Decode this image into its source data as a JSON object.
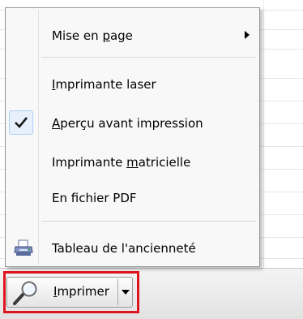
{
  "menu": {
    "items": [
      {
        "id": "mise-en-page",
        "before": "Mise en ",
        "accel": "p",
        "after": "age",
        "has_submenu": true
      },
      {
        "id": "imprimante-laser",
        "before": "",
        "accel": "I",
        "after": "mprimante laser"
      },
      {
        "id": "apercu",
        "before": "",
        "accel": "A",
        "after": "perçu avant impression",
        "checked": true
      },
      {
        "id": "matricielle",
        "before": "Imprimante ",
        "accel": "m",
        "after": "atricielle"
      },
      {
        "id": "pdf",
        "before": "En fichier PDF",
        "accel": "",
        "after": ""
      },
      {
        "id": "anciennete",
        "before": "Tableau de l'ancienneté",
        "accel": "",
        "after": "",
        "icon": "printer-icon"
      }
    ]
  },
  "toolbar": {
    "print_before": "",
    "print_accel": "I",
    "print_after": "mprimer",
    "print_icon": "magnifier-icon",
    "dropdown_icon": "chevron-down-icon"
  },
  "colors": {
    "highlight_border": "#e0141e",
    "check_bg": "#e8f1fb"
  }
}
